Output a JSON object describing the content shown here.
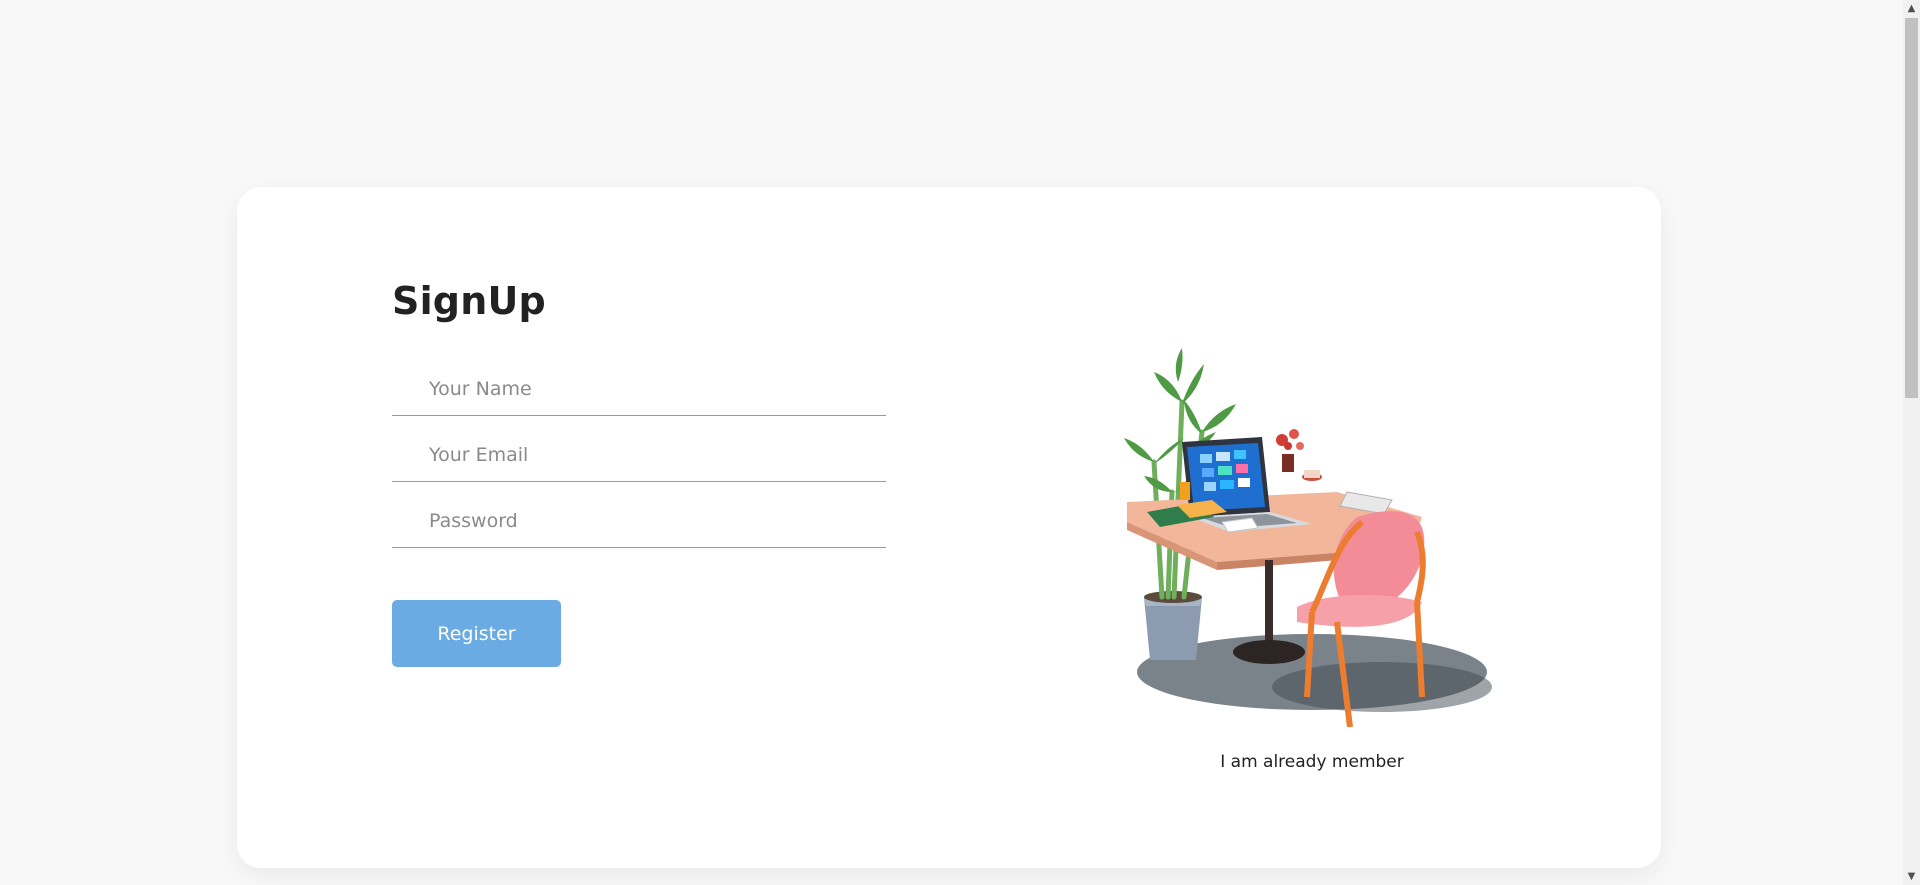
{
  "signup": {
    "title": "SignUp",
    "name_placeholder": "Your Name",
    "email_placeholder": "Your Email",
    "password_placeholder": "Password",
    "register_label": "Register"
  },
  "aside": {
    "member_link": "I am already member"
  },
  "colors": {
    "page_bg": "#f8f8f8",
    "card_bg": "#ffffff",
    "button": "#6aabe3",
    "title": "#222222"
  },
  "icons": {
    "illustration": "desk-laptop-chair-illustration",
    "scroll_up": "scroll-up-arrow-icon",
    "scroll_down": "scroll-down-arrow-icon"
  }
}
